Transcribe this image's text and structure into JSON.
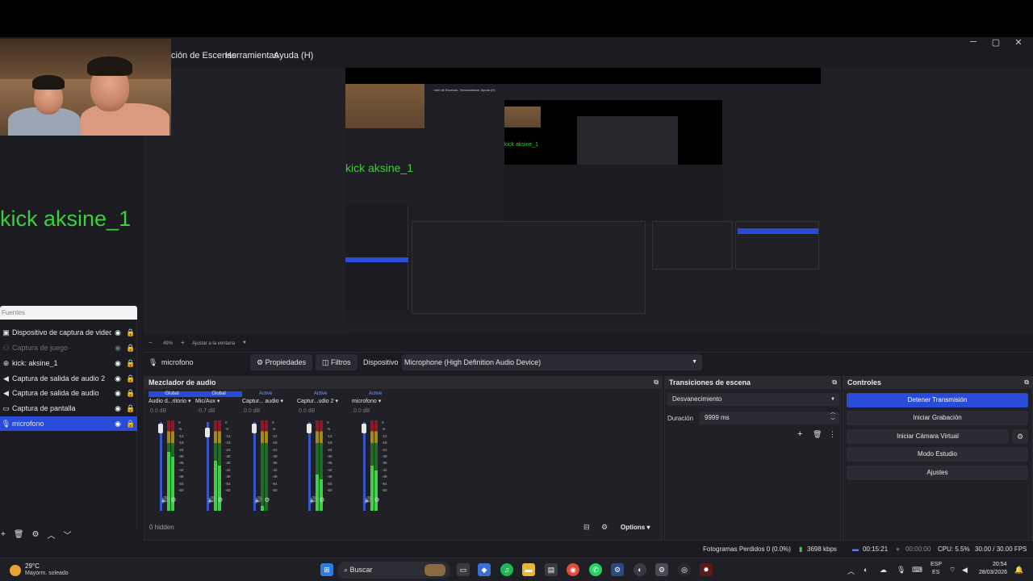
{
  "menu": {
    "items": [
      "ción de Escenas",
      "Herramientas",
      "Ayuda (H)"
    ]
  },
  "window_controls": {
    "minimize": "─",
    "maximize": "▢",
    "close": "✕"
  },
  "overlay": {
    "text": "kick aksine_1"
  },
  "preview": {
    "nested_menu": [
      "ción de Escenas",
      "Herramientas",
      "Ayuda (H)"
    ]
  },
  "zoom": {
    "minus": "−",
    "value": "49%",
    "plus": "+",
    "fit_label": "Ajustar a la ventana"
  },
  "sources": {
    "header": "Fuentes",
    "items": [
      {
        "label": "Dispositivo de captura de video",
        "icon": "camera-icon",
        "glyph": "▣",
        "dim": false,
        "selected": false
      },
      {
        "label": "Captura de juego",
        "icon": "gamepad-icon",
        "glyph": "⚇",
        "dim": true,
        "selected": false
      },
      {
        "label": "kick: aksine_1",
        "icon": "browser-icon",
        "glyph": "⊕",
        "dim": false,
        "selected": false
      },
      {
        "label": "Captura de salida de audio 2",
        "icon": "speaker-icon",
        "glyph": "◀",
        "dim": false,
        "selected": false
      },
      {
        "label": "Captura de salida de audio",
        "icon": "speaker-icon",
        "glyph": "◀",
        "dim": false,
        "selected": false
      },
      {
        "label": "Captura de pantalla",
        "icon": "monitor-icon",
        "glyph": "▭",
        "dim": false,
        "selected": false
      },
      {
        "label": "microfono",
        "icon": "microphone-icon",
        "glyph": "🎙",
        "dim": false,
        "selected": true
      }
    ],
    "toolbar": {
      "add": "+",
      "remove": "🗑",
      "settings": "⚙",
      "up": "︿",
      "down": "﹀"
    }
  },
  "properties_bar": {
    "selected_source": "microfono",
    "properties_label": "Propiedades",
    "filters_label": "Filtros",
    "device_label": "Dispositivo",
    "device_value": "Microphone (High Definition Audio Device)"
  },
  "mixer": {
    "title": "Mezclador de audio",
    "channels": [
      {
        "badge": "Global",
        "name": "Audio d...ritorio",
        "db": "0.0 dB",
        "level": 0.65
      },
      {
        "badge": "Global",
        "name": "Mic/Aux",
        "db": "-0.7 dB",
        "level": 0.55
      },
      {
        "badge": "Active",
        "name": "Captur... audio",
        "db": "0.0 dB",
        "level": 0.05
      },
      {
        "badge": "Active",
        "name": "Captur...udio 2",
        "db": "0.0 dB",
        "level": 0.4
      },
      {
        "badge": "Active",
        "name": "microfono",
        "db": "0.0 dB",
        "level": 0.5
      }
    ],
    "scale": [
      "0",
      "-6",
      "-12",
      "-18",
      "-24",
      "-30",
      "-36",
      "-42",
      "-48",
      "-54",
      "-60"
    ],
    "hidden_count": "0 hidden",
    "options_label": "Options"
  },
  "transitions": {
    "title": "Transiciones de escena",
    "selected": "Desvanecimiento",
    "duration_label": "Duración",
    "duration_value": "9999 ms"
  },
  "controls": {
    "title": "Controles",
    "stream_button": "Detener Transmisión",
    "record_button": "Iniciar Grabación",
    "virtual_cam_button": "Iniciar Cámara Virtual",
    "studio_button": "Modo Estudio",
    "settings_button": "Ajustes"
  },
  "status": {
    "dropped_frames": "Fotogramas Perdidos 0 (0.0%)",
    "bitrate": "3698 kbps",
    "stream_time": "00:15:21",
    "record_time": "00:00:00",
    "cpu": "CPU: 5.5%",
    "fps": "30.00 / 30.00 FPS"
  },
  "taskbar": {
    "weather_temp": "29°C",
    "weather_desc": "Mayorm. soleado",
    "search_placeholder": "Buscar",
    "language": "ESP",
    "language_sub": "ES",
    "time": "20:54",
    "date": "28/03/2026"
  },
  "colors": {
    "accent": "#2a4bd7",
    "overlay_green": "#3ad13a",
    "meter_green": "#3fd04a"
  }
}
